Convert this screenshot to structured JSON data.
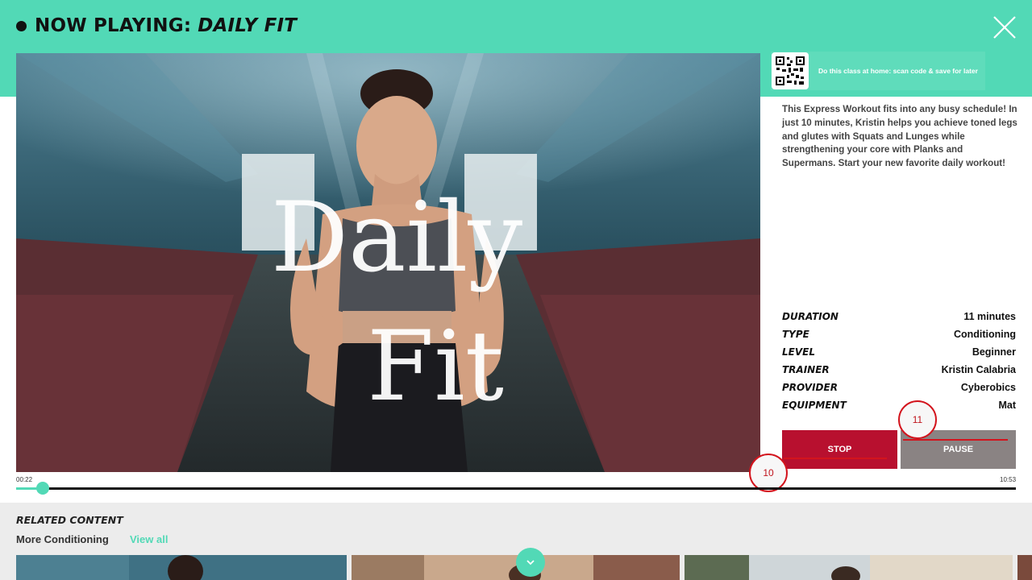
{
  "header": {
    "prefix": "NOW PLAYING:",
    "class_name": "DAILY FIT",
    "accent_color": "#52d9b6"
  },
  "video": {
    "overlay_line1": "Daily",
    "overlay_line2": "Fit"
  },
  "qr": {
    "text": "Do this class at home: scan code & save for later"
  },
  "description": "This Express Workout fits into any busy schedule! In just 10 minutes, Kristin helps you achieve toned legs and glutes with Squats and Lunges while strengthening your core with Planks and Supermans. Start your new favorite daily workout!",
  "details": [
    {
      "key": "DURATION",
      "value": "11 minutes"
    },
    {
      "key": "TYPE",
      "value": "Conditioning"
    },
    {
      "key": "LEVEL",
      "value": "Beginner"
    },
    {
      "key": "TRAINER",
      "value": "Kristin Calabria"
    },
    {
      "key": "PROVIDER",
      "value": "Cyberobics"
    },
    {
      "key": "EQUIPMENT",
      "value": "Mat"
    }
  ],
  "buttons": {
    "stop": "STOP",
    "pause": "PAUSE",
    "stop_color": "#b8102f",
    "pause_color": "#8a8383"
  },
  "markers": {
    "m10": "10",
    "m11": "11"
  },
  "playback": {
    "current_time": "00:22",
    "total_time": "10:53",
    "progress": 0.027
  },
  "related": {
    "title": "RELATED CONTENT",
    "subtitle": "More Conditioning",
    "view_all": "View all"
  }
}
